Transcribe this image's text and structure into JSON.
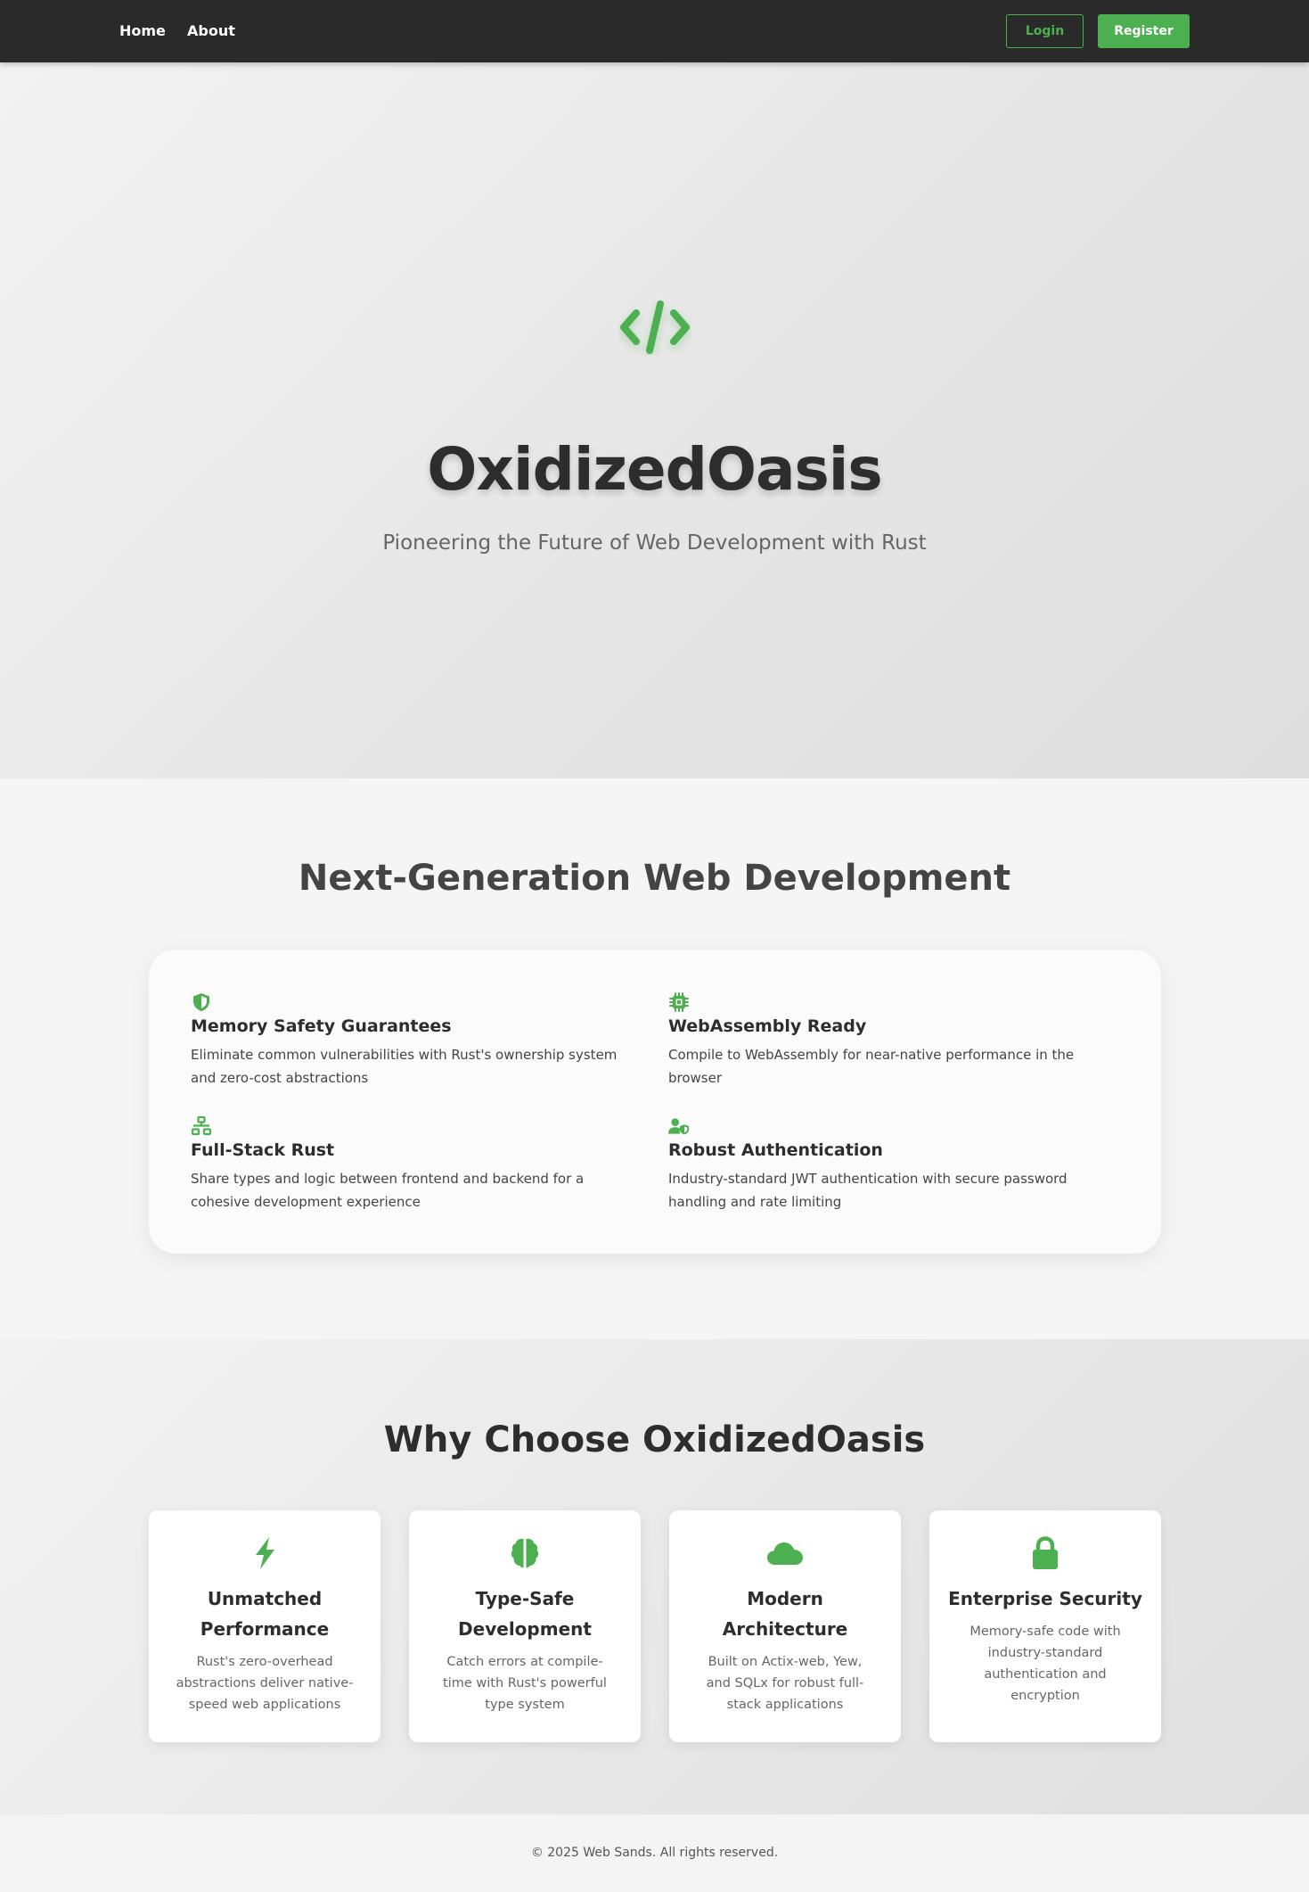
{
  "colors": {
    "accent": "#4caf50",
    "nav_bg": "#2a2a2a",
    "text_dark": "#2d2d2d",
    "text_muted": "#666666"
  },
  "nav": {
    "links": [
      "Home",
      "About"
    ],
    "login_label": "Login",
    "register_label": "Register"
  },
  "hero": {
    "icon": "code-icon",
    "title": "OxidizedOasis",
    "subtitle": "Pioneering the Future of Web Development with Rust"
  },
  "features": {
    "title": "Next-Generation Web Development",
    "items": [
      {
        "icon": "shield-icon",
        "title": "Memory Safety Guarantees",
        "desc": "Eliminate common vulnerabilities with Rust's ownership system and zero-cost abstractions"
      },
      {
        "icon": "microchip-icon",
        "title": "WebAssembly Ready",
        "desc": "Compile to WebAssembly for near-native performance in the browser"
      },
      {
        "icon": "network-icon",
        "title": "Full-Stack Rust",
        "desc": "Share types and logic between frontend and backend for a cohesive development experience"
      },
      {
        "icon": "user-shield-icon",
        "title": "Robust Authentication",
        "desc": "Industry-standard JWT authentication with secure password handling and rate limiting"
      }
    ]
  },
  "why": {
    "title": "Why Choose OxidizedOasis",
    "cards": [
      {
        "icon": "bolt-icon",
        "title": "Unmatched Performance",
        "desc": "Rust's zero-overhead abstractions deliver native-speed web applications"
      },
      {
        "icon": "brain-icon",
        "title": "Type-Safe Development",
        "desc": "Catch errors at compile-time with Rust's powerful type system"
      },
      {
        "icon": "cloud-icon",
        "title": "Modern Architecture",
        "desc": "Built on Actix-web, Yew, and SQLx for robust full-stack applications"
      },
      {
        "icon": "lock-icon",
        "title": "Enterprise Security",
        "desc": "Memory-safe code with industry-standard authentication and encryption"
      }
    ]
  },
  "footer": {
    "text": "© 2025 Web Sands. All rights reserved."
  }
}
